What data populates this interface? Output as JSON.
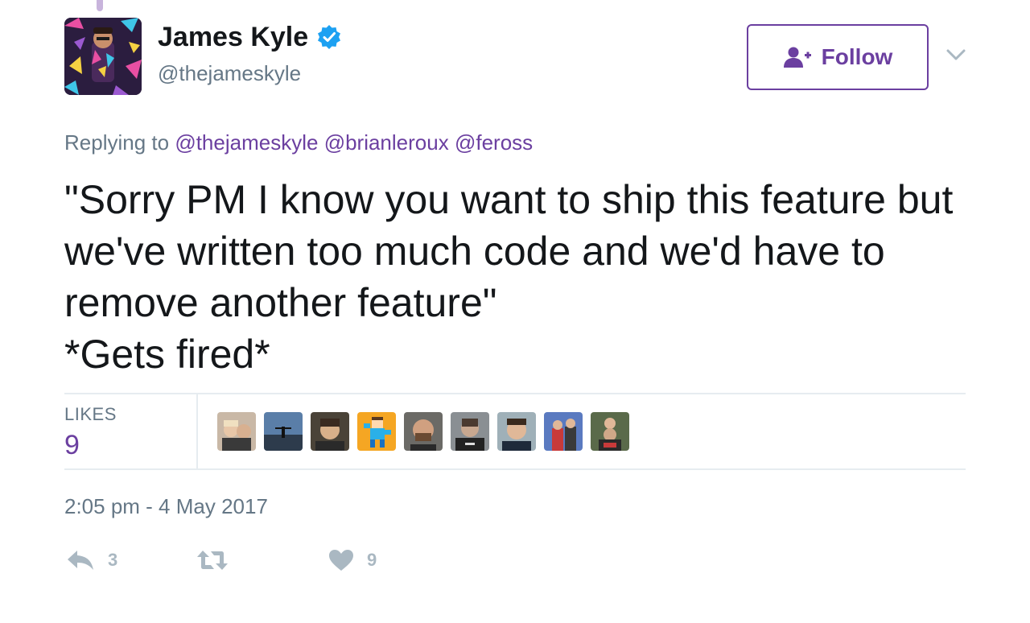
{
  "author": {
    "display_name": "James Kyle",
    "handle": "@thejameskyle",
    "verified_icon": "verified-badge-icon",
    "avatar": "profile-avatar"
  },
  "follow_button": {
    "label": "Follow",
    "icon": "add-user-icon"
  },
  "menu_icon": "chevron-down-icon",
  "reply": {
    "prefix": "Replying to",
    "mentions": [
      "@thejameskyle",
      "@brianleroux",
      "@feross"
    ]
  },
  "tweet": {
    "text": "\"Sorry PM I know you want to ship this feature but we've written too much code and we'd have to remove another feature\"\n*Gets fired*"
  },
  "likes": {
    "label": "LIKES",
    "count": "9",
    "liker_avatars": 9
  },
  "timestamp": "2:05 pm - 4 May 2017",
  "actions": {
    "reply": {
      "icon": "reply-icon",
      "count": "3"
    },
    "retweet": {
      "icon": "retweet-icon",
      "count": ""
    },
    "like": {
      "icon": "heart-icon",
      "count": "9"
    }
  },
  "colors": {
    "accent": "#6b3fa0",
    "verified": "#1da1f2",
    "muted": "#657786",
    "action_gray": "#aab8c2",
    "divider": "#e6ecf0"
  }
}
